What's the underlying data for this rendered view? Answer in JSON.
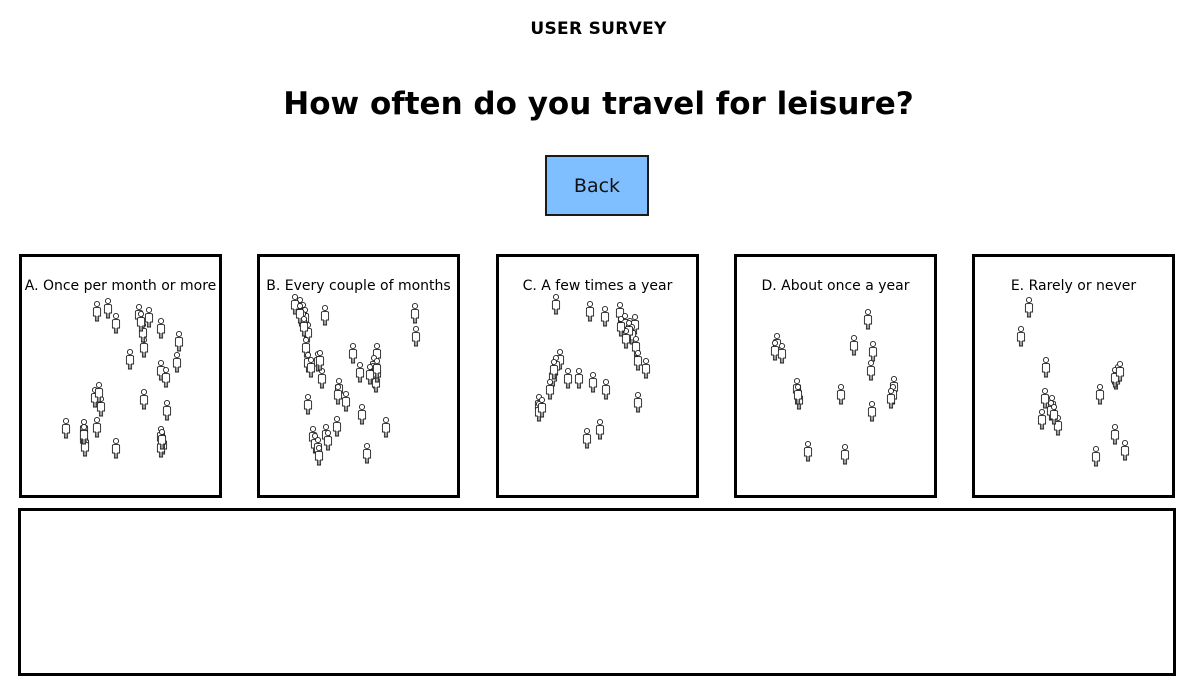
{
  "survey": {
    "header": "USER SURVEY",
    "question": "How often do you travel for leisure?",
    "back_label": "Back"
  },
  "options": [
    {
      "label": "A. Once per month or more",
      "icon": "person-icon",
      "count": 31
    },
    {
      "label": "B. Every couple of months",
      "icon": "person-icon",
      "count": 41
    },
    {
      "label": "C. A few times a year",
      "icon": "person-icon",
      "count": 29
    },
    {
      "label": "D. About once a year",
      "icon": "person-icon",
      "count": 17
    },
    {
      "label": "E. Rarely or never",
      "icon": "person-icon",
      "count": 17
    }
  ],
  "colors": {
    "back_button": "#7fbfff",
    "border": "#000000",
    "background": "#ffffff"
  }
}
